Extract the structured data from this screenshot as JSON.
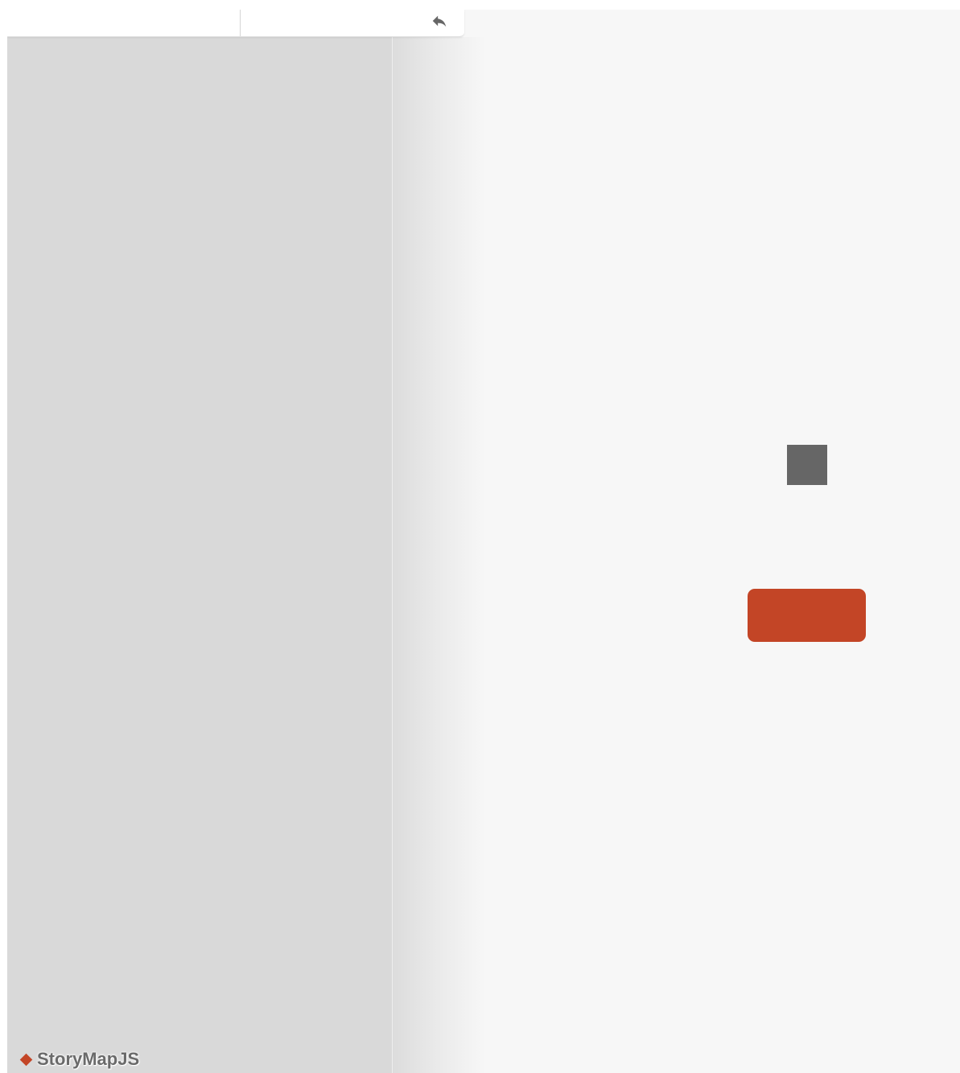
{
  "toolbar": {
    "back_icon": "reply-arrow-icon"
  },
  "loading": {
    "icon": "loading-square-icon"
  },
  "accent_button": {
    "label": ""
  },
  "branding": {
    "name": "StoryMapJS",
    "logo_icon": "diamond-icon"
  },
  "colors": {
    "accent": "#c34526",
    "map_background": "#d9d9d9",
    "panel_background": "#f7f7f7",
    "icon_gray": "#666666",
    "text_gray": "#6a6a6a"
  }
}
